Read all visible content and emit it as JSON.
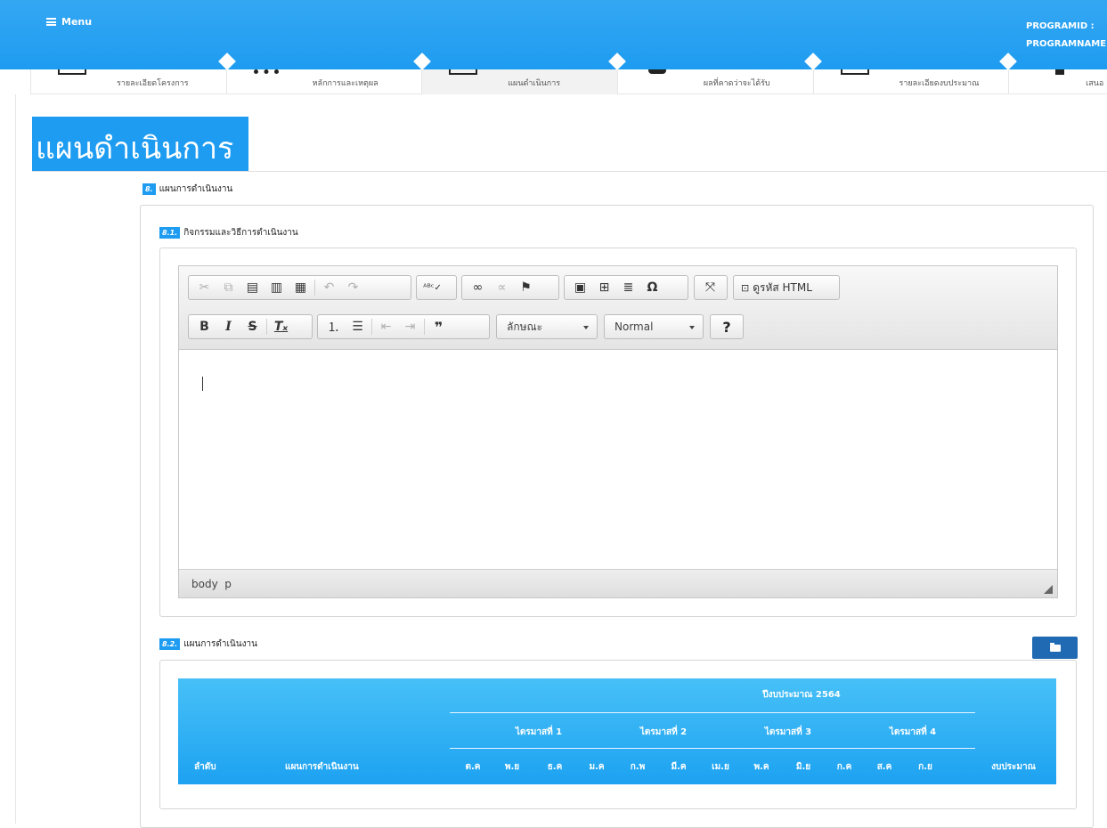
{
  "topbar": {
    "menu_label": "Menu",
    "program_id": "PROGRAMID :",
    "program_name": "PROGRAMNAME"
  },
  "steps": [
    {
      "label": "รายละเอียดโครงการ"
    },
    {
      "label": "หลักการและเหตุผล"
    },
    {
      "label": "แผนดำเนินการ"
    },
    {
      "label": "ผลที่คาดว่าจะได้รับ"
    },
    {
      "label": "รายละเอียดงบประมาณ"
    },
    {
      "label": "เสนอ"
    }
  ],
  "page_title": "แผนดำเนินการ",
  "section": {
    "number": "8.",
    "label": "แผนการดำเนินงาน"
  },
  "subsection_1": {
    "number": "8.1.",
    "label": "กิจกรรมและวิธีการดำเนินงาน"
  },
  "editor": {
    "style_combo": "ลักษณะ",
    "format_combo": "Normal",
    "source_label": "ดูรหัส HTML",
    "help_label": "?",
    "path_label": "body  p"
  },
  "subsection_2": {
    "number": "8.2.",
    "label": "แผนการดำเนินงาน"
  },
  "table": {
    "year_header": "ปีงบประมาณ 2564",
    "order_header": "ลำดับ",
    "plan_header": "แผนการดำเนินงาน",
    "budget_header": "งบประมาณ",
    "quarters": [
      "ไตรมาสที่ 1",
      "ไตรมาสที่ 2",
      "ไตรมาสที่ 3",
      "ไตรมาสที่ 4"
    ],
    "months": [
      "ต.ค",
      "พ.ย",
      "ธ.ค",
      "ม.ค",
      "ก.พ",
      "มี.ค",
      "เม.ย",
      "พ.ค",
      "มิ.ย",
      "ก.ค",
      "ส.ค",
      "ก.ย"
    ]
  }
}
